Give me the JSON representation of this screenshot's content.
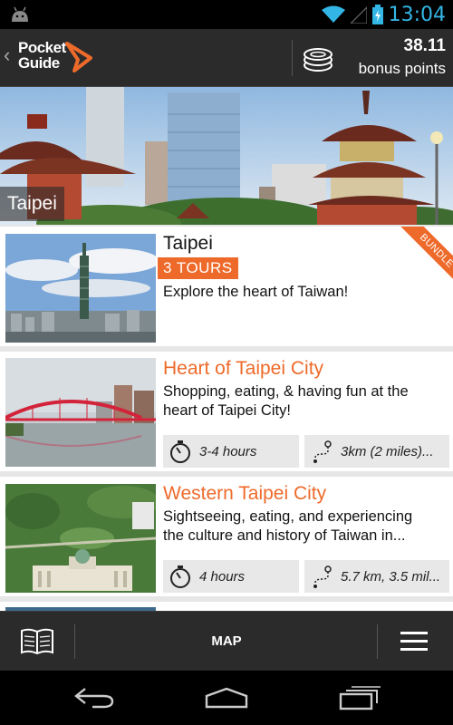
{
  "status_bar": {
    "time": "13:04"
  },
  "app_bar": {
    "logo_line1": "Pocket",
    "logo_line2": "Guide",
    "points_value": "38.11",
    "points_label": "bonus points"
  },
  "hero": {
    "city": "Taipei"
  },
  "bundle": {
    "title": "Taipei",
    "tours_badge": "3 TOURS",
    "description": "Explore the heart of Taiwan!",
    "ribbon": "BUNDLE"
  },
  "tours": [
    {
      "title": "Heart of Taipei City",
      "description_line1": "Shopping, eating, & having fun at the",
      "description_line2": "heart of Taipei City!",
      "duration": "3-4 hours",
      "distance": "3km (2 miles)..."
    },
    {
      "title": "Western Taipei City",
      "description_line1": "Sightseeing, eating, and experiencing",
      "description_line2": "the culture and history of Taiwan in...",
      "duration": "4 hours",
      "distance": "5.7 km, 3.5 mil..."
    }
  ],
  "toolbar": {
    "map_label": "MAP"
  },
  "colors": {
    "accent": "#ee6a2a",
    "bar": "#2b2b2b",
    "status_blue": "#33b5e5"
  },
  "icons": [
    "android-icon",
    "wifi-icon",
    "signal-icon",
    "battery-icon",
    "back-chevron-icon",
    "logo-arrow-icon",
    "coins-icon",
    "stopwatch-icon",
    "route-icon",
    "book-icon",
    "hamburger-menu-icon",
    "nav-back-icon",
    "nav-home-icon",
    "nav-recents-icon"
  ]
}
